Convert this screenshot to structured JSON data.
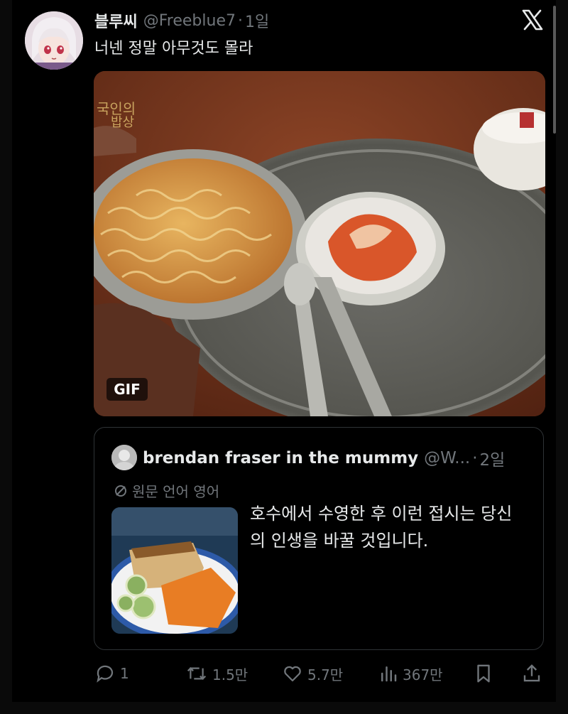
{
  "tweet": {
    "author_name": "블루씨",
    "handle": "@Freeblue7",
    "separator": "·",
    "time": "1일",
    "text": "너넨 정말 아무것도 몰라",
    "media_badge": "GIF"
  },
  "quote": {
    "author_name": "brendan fraser in the mummy",
    "handle": "@W...",
    "separator": "·",
    "time": "2일",
    "language_note": "원문 언어 영어",
    "text": "호수에서 수영한 후 이런 접시는 당신의 인생을 바꿀 것입니다."
  },
  "actions": {
    "replies": "1",
    "retweets": "1.5만",
    "likes": "5.7만",
    "views": "367만"
  },
  "icons": {
    "brand": "x-logo-icon",
    "reply": "reply-icon",
    "retweet": "retweet-icon",
    "like": "heart-icon",
    "views": "views-icon",
    "bookmark": "bookmark-icon",
    "share": "share-icon",
    "language": "translate-icon"
  },
  "colors": {
    "background": "#000000",
    "text": "#e7e9ea",
    "muted": "#71767b",
    "border": "#2f3336"
  }
}
